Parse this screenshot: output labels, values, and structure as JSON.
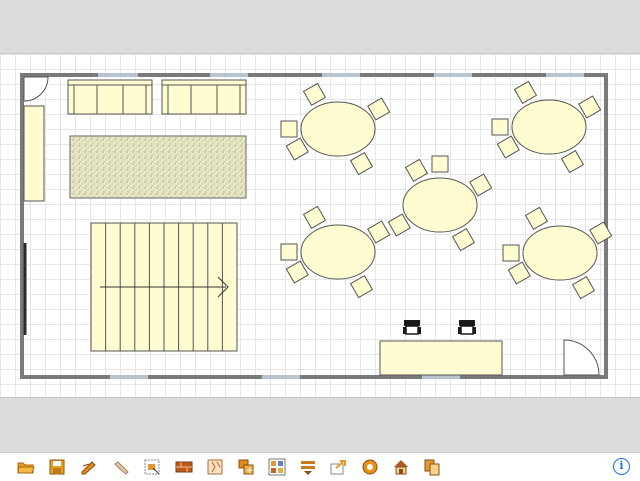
{
  "plan": {
    "colors": {
      "wall": "#7a7a7a",
      "window": "#b8c4d0",
      "furniture_fill": "#fffcd2",
      "furniture_stroke": "#555555",
      "rug": "#e6e6c0",
      "chair_black": "#1a1a1a"
    },
    "furniture": [
      {
        "kind": "door",
        "name": "entrance-door-top-left"
      },
      {
        "kind": "sofa",
        "name": "sofa-left"
      },
      {
        "kind": "sofa",
        "name": "sofa-right"
      },
      {
        "kind": "cabinet",
        "name": "side-cabinet"
      },
      {
        "kind": "rug",
        "name": "textured-rug"
      },
      {
        "kind": "staircase",
        "name": "staircase"
      },
      {
        "kind": "round-table",
        "name": "round-table",
        "count": 5
      },
      {
        "kind": "chair",
        "name": "table-chair",
        "count": 20
      },
      {
        "kind": "desk",
        "name": "reception-desk"
      },
      {
        "kind": "office-chair",
        "name": "office-chair",
        "count": 2
      },
      {
        "kind": "door",
        "name": "door-bottom-right"
      }
    ]
  },
  "toolbar": {
    "buttons": [
      {
        "name": "open-folder-icon",
        "color": "#e89a1c"
      },
      {
        "name": "save-icon",
        "color": "#e8a020"
      },
      {
        "name": "edit-pencil-icon",
        "color": "#e8881c"
      },
      {
        "name": "pan-hand-icon",
        "color": "#d8b890"
      },
      {
        "name": "select-room-icon",
        "color": "#e09830"
      },
      {
        "name": "create-walls-icon",
        "color": "#c05a1a"
      },
      {
        "name": "create-rooms-icon",
        "color": "#e0a060"
      },
      {
        "name": "add-furniture-icon",
        "color": "#e08a20"
      },
      {
        "name": "furniture-catalog-icon",
        "color": "#e09a30"
      },
      {
        "name": "create-level-icon",
        "color": "#c87a20"
      },
      {
        "name": "export-icon",
        "color": "#e89a1c"
      },
      {
        "name": "preferences-gear-icon",
        "color": "#e8901a"
      },
      {
        "name": "3d-view-house-icon",
        "color": "#d88a30"
      },
      {
        "name": "copy-icon",
        "color": "#e09a30"
      }
    ],
    "info_label": "i",
    "info_color": "#1a73d9"
  }
}
